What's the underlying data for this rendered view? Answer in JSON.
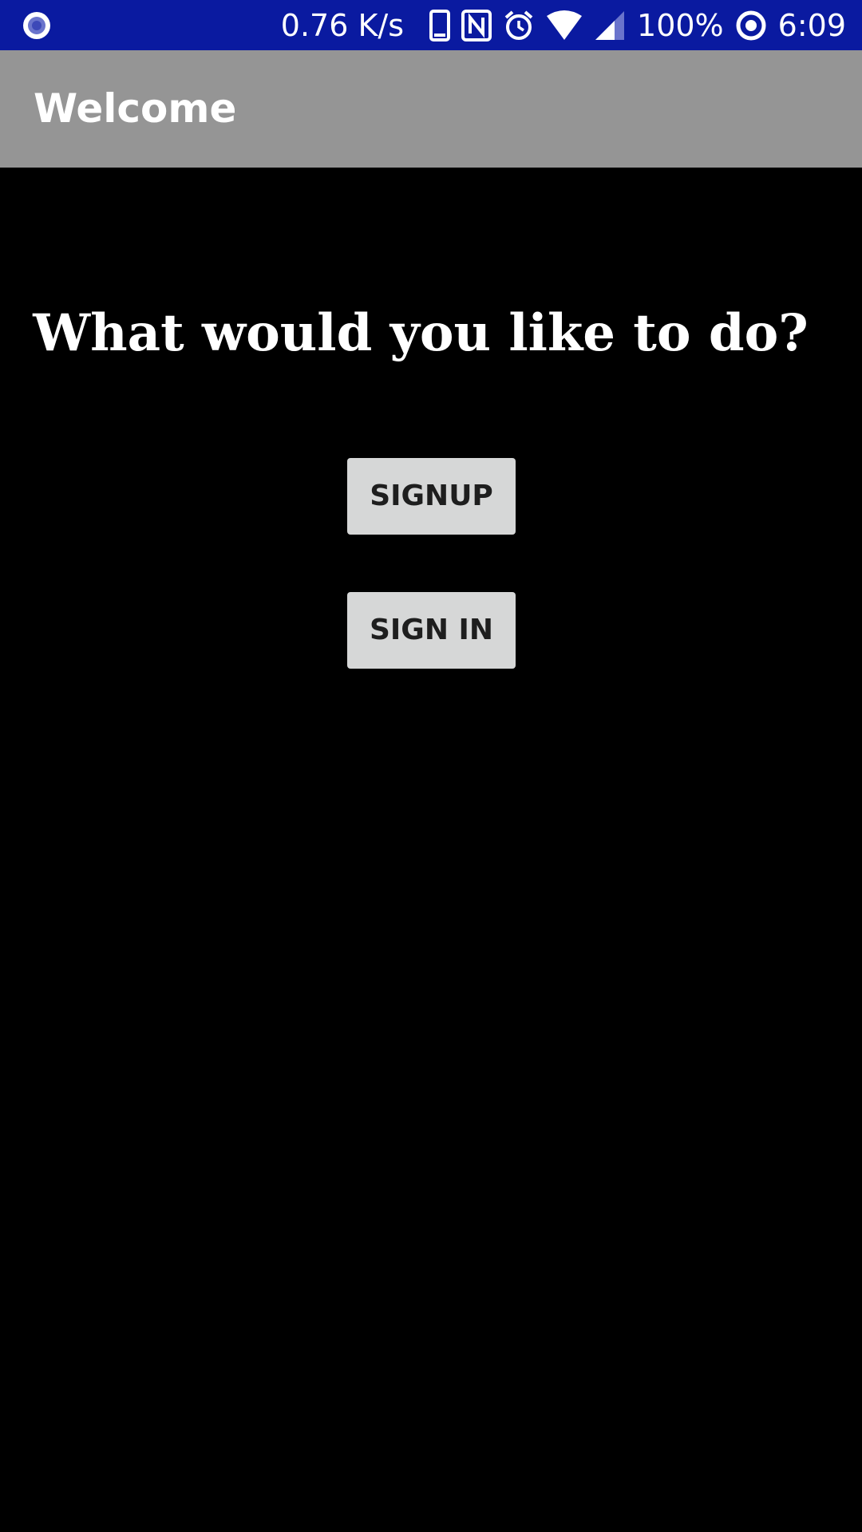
{
  "status_bar": {
    "background": "#0a1aa0",
    "net_speed": "0.76 K/s",
    "battery": "100%",
    "time": "6:09",
    "icons": [
      "notification-dot-icon",
      "phone-icon",
      "nfc-icon",
      "alarm-icon",
      "wifi-icon",
      "signal-icon",
      "data-saver-icon"
    ]
  },
  "app_bar": {
    "title": "Welcome",
    "background": "#959595"
  },
  "main": {
    "prompt": "What would you like to do?",
    "signup_label": "SIGNUP",
    "signin_label": "SIGN IN",
    "button_color": "#d6d7d7"
  }
}
